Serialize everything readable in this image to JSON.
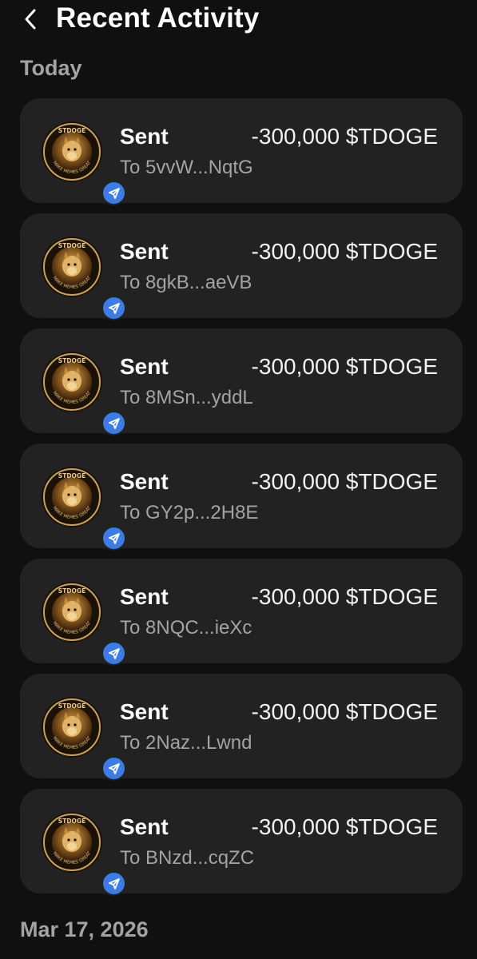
{
  "header": {
    "title": "Recent Activity",
    "back_icon": "chevron-left-icon"
  },
  "sections": [
    {
      "label": "Today"
    },
    {
      "label": "Mar 17, 2026"
    }
  ],
  "colors": {
    "background": "#101010",
    "card": "#222222",
    "accent": "#3b7ce8",
    "muted_text": "#a3a3a3"
  },
  "token_logo_text": {
    "top": "STDOGE",
    "ring": "MAKE MEMES GREAT"
  },
  "transactions": [
    {
      "type": "Sent",
      "amount": "-300,000 $TDOGE",
      "recipient": "To 5vvW...NqtG",
      "icon": "paper-plane-icon"
    },
    {
      "type": "Sent",
      "amount": "-300,000 $TDOGE",
      "recipient": "To 8gkB...aeVB",
      "icon": "paper-plane-icon"
    },
    {
      "type": "Sent",
      "amount": "-300,000 $TDOGE",
      "recipient": "To 8MSn...yddL",
      "icon": "paper-plane-icon"
    },
    {
      "type": "Sent",
      "amount": "-300,000 $TDOGE",
      "recipient": "To GY2p...2H8E",
      "icon": "paper-plane-icon"
    },
    {
      "type": "Sent",
      "amount": "-300,000 $TDOGE",
      "recipient": "To 8NQC...ieXc",
      "icon": "paper-plane-icon"
    },
    {
      "type": "Sent",
      "amount": "-300,000 $TDOGE",
      "recipient": "To 2Naz...Lwnd",
      "icon": "paper-plane-icon"
    },
    {
      "type": "Sent",
      "amount": "-300,000 $TDOGE",
      "recipient": "To BNzd...cqZC",
      "icon": "paper-plane-icon"
    }
  ]
}
